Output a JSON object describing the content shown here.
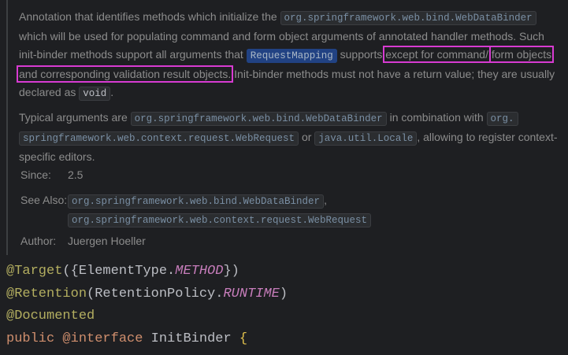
{
  "doc": {
    "p1": {
      "t1": "Annotation that identifies methods which initialize the ",
      "c1": "org.springframework.web.bind.WebDataBinder",
      "t2": " which will be used for populating command and form object arguments of annotated handler methods. Such init-binder methods support all arguments that ",
      "c2": "RequestMapping",
      "t3": " supports,",
      "h1": "except for command/",
      "h2": "form objects and corresponding validation result objects.",
      "t4": " Init-binder methods must not have a return value; they are usually declared as ",
      "c3": "void",
      "t5": "."
    },
    "p2": {
      "t1": "Typical arguments are ",
      "c1": "org.springframework.web.bind.WebDataBinder",
      "t2": " in combination with ",
      "c2": "org.",
      "c3": "springframework.web.context.request.WebRequest",
      "t3": " or ",
      "c4": "java.util.Locale",
      "t4": ", allowing to register context-specific editors."
    },
    "since_label": "Since:",
    "since_value": "2.5",
    "see_also_label": "See Also:",
    "see_also": [
      "org.springframework.web.bind.WebDataBinder",
      "org.springframework.web.context.request.WebRequest"
    ],
    "author_label": "Author:",
    "author_value": "Juergen Hoeller"
  },
  "source": {
    "line1": {
      "at": "@Target",
      "open": "({ElementType.",
      "const": "METHOD",
      "close": "})"
    },
    "line2": {
      "at": "@Retention",
      "open": "(RetentionPolicy.",
      "const": "RUNTIME",
      "close": ")"
    },
    "line3": {
      "at": "@Documented"
    },
    "line4": {
      "kw": "public",
      "at": "@interface",
      "name": " InitBinder ",
      "brace": "{"
    }
  }
}
